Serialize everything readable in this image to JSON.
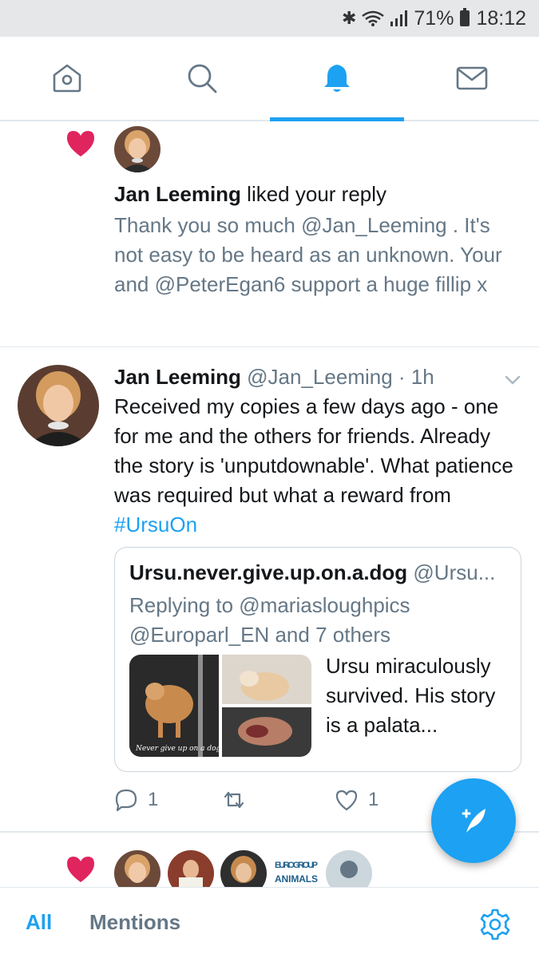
{
  "status_bar": {
    "battery": "71%",
    "time": "18:12",
    "icons": [
      "bluetooth-icon",
      "wifi-icon",
      "signal-icon",
      "battery-icon"
    ]
  },
  "nav": {
    "tabs": [
      {
        "icon": "home-icon",
        "active": false
      },
      {
        "icon": "search-icon",
        "active": false
      },
      {
        "icon": "bell-icon",
        "active": true
      },
      {
        "icon": "mail-icon",
        "active": false
      }
    ]
  },
  "notification_like": {
    "icon": "heart-icon",
    "user": "Jan Leeming",
    "action": " liked your reply",
    "text": "Thank you so much @Jan_Leeming . It's not easy to be heard as an unknown. Your and @PeterEgan6 support a huge fillip x"
  },
  "tweet": {
    "name": "Jan Leeming",
    "meta": " @Jan_Leeming · 1h",
    "text": "Received my copies a few days ago - one for me and the others for friends. Already the story is 'unputdownable'. What patience was required but what a reward from ",
    "hashtag": "#UrsuOn",
    "quote": {
      "name": "Ursu.never.give.up.on.a.dog",
      "meta": " @Ursu...",
      "replying": "Replying to @mariasloughpics @Europarl_EN and 7 others",
      "image_caption": "Never give up on a dog",
      "text": "Ursu miraculously survived. His story is a palata..."
    },
    "actions": {
      "reply_count": "1",
      "retweet_count": "",
      "like_count": "1"
    }
  },
  "notification_like_2": {
    "icon": "heart-icon",
    "avatar_logo_text": "EUROGROUP FOR ANIMALS"
  },
  "bottom_tabs": {
    "all": "All",
    "mentions": "Mentions"
  },
  "colors": {
    "accent": "#1da1f2",
    "heart": "#e0245e",
    "secondary_text": "#657786"
  }
}
